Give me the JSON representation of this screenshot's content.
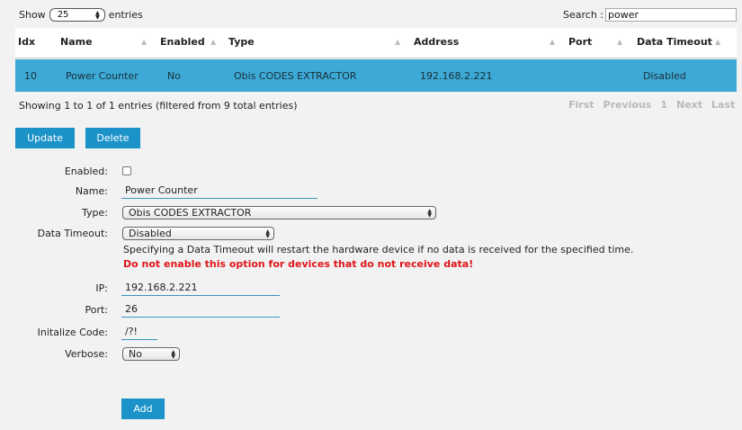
{
  "controls": {
    "show_label": "Show",
    "entries_value": "25",
    "entries_label": "entries",
    "search_label": "Search :",
    "search_value": "power"
  },
  "table": {
    "headers": [
      "Idx",
      "Name",
      "Enabled",
      "Type",
      "Address",
      "Port",
      "Data Timeout"
    ],
    "rows": [
      {
        "idx": "10",
        "name": "Power Counter",
        "enabled": "No",
        "type": "Obis CODES EXTRACTOR",
        "address": "192.168.2.221",
        "port": "",
        "data_timeout": "Disabled"
      }
    ]
  },
  "info_text": "Showing 1 to 1 of 1 entries (filtered from 9 total entries)",
  "pager": {
    "first": "First",
    "previous": "Previous",
    "page": "1",
    "next": "Next",
    "last": "Last"
  },
  "buttons": {
    "update": "Update",
    "delete": "Delete",
    "add": "Add"
  },
  "form": {
    "enabled_label": "Enabled:",
    "name_label": "Name:",
    "name_value": "Power Counter",
    "type_label": "Type:",
    "type_value": "Obis CODES EXTRACTOR",
    "timeout_label": "Data Timeout:",
    "timeout_value": "Disabled",
    "timeout_note": "Specifying a Data Timeout will restart the hardware device if no data is received for the specified time.",
    "timeout_warning": "Do not enable this option for devices that do not receive data!",
    "ip_label": "IP:",
    "ip_value": "192.168.2.221",
    "port_label": "Port:",
    "port_value": "26",
    "init_label": "Initalize Code:",
    "init_value": "/?!",
    "verbose_label": "Verbose:",
    "verbose_value": "No"
  },
  "colors": {
    "accent": "#1b92c8",
    "selected_row": "#3ca9d6",
    "warning": "#e0161b"
  }
}
